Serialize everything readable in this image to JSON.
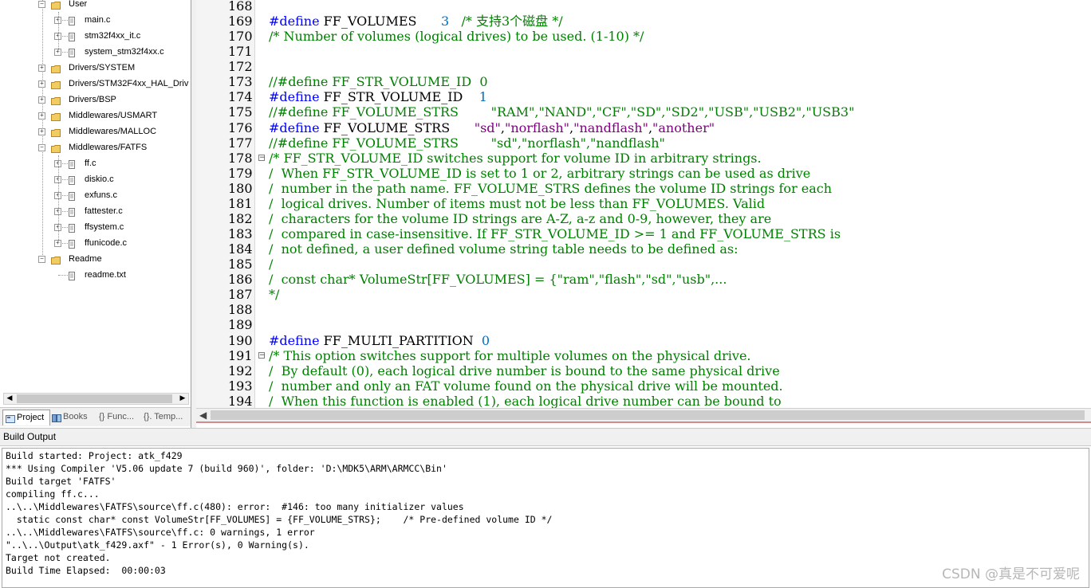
{
  "project_tree": {
    "items": [
      {
        "label": "User",
        "type": "folder",
        "expander": "−"
      },
      {
        "label": "main.c",
        "type": "file",
        "expander": "+"
      },
      {
        "label": "stm32f4xx_it.c",
        "type": "file",
        "expander": "+"
      },
      {
        "label": "system_stm32f4xx.c",
        "type": "file",
        "expander": "+"
      },
      {
        "label": "Drivers/SYSTEM",
        "type": "folder",
        "expander": "+"
      },
      {
        "label": "Drivers/STM32F4xx_HAL_Driv",
        "type": "folder",
        "expander": "+"
      },
      {
        "label": "Drivers/BSP",
        "type": "folder",
        "expander": "+"
      },
      {
        "label": "Middlewares/USMART",
        "type": "folder",
        "expander": "+"
      },
      {
        "label": "Middlewares/MALLOC",
        "type": "folder",
        "expander": "+"
      },
      {
        "label": "Middlewares/FATFS",
        "type": "folder",
        "expander": "−"
      },
      {
        "label": "ff.c",
        "type": "file",
        "expander": "+"
      },
      {
        "label": "diskio.c",
        "type": "file",
        "expander": "+"
      },
      {
        "label": "exfuns.c",
        "type": "file",
        "expander": "+"
      },
      {
        "label": "fattester.c",
        "type": "file",
        "expander": "+"
      },
      {
        "label": "ffsystem.c",
        "type": "file",
        "expander": "+"
      },
      {
        "label": "ffunicode.c",
        "type": "file",
        "expander": "+"
      },
      {
        "label": "Readme",
        "type": "folder",
        "expander": "−"
      },
      {
        "label": "readme.txt",
        "type": "file",
        "expander": ""
      }
    ],
    "scroll_left": "◀",
    "scroll_right": "▶"
  },
  "project_tabs": [
    {
      "label": "Project",
      "icon": "project-icon"
    },
    {
      "label": "Books",
      "icon": "books-icon"
    },
    {
      "label": "{} Func...",
      "icon": "functions-icon"
    },
    {
      "label": "{}. Temp...",
      "icon": "templates-icon"
    }
  ],
  "editor": {
    "scroll_left": "◀",
    "lines": [
      {
        "n": "168",
        "fold": "",
        "tokens": []
      },
      {
        "n": "169",
        "fold": "",
        "tokens": [
          {
            "c": "pp",
            "t": "#define"
          },
          {
            "c": "def",
            "t": " FF_VOLUMES      "
          },
          {
            "c": "num",
            "t": "3"
          },
          {
            "c": "cmt",
            "t": "   /* 支持3个磁盘 */"
          }
        ]
      },
      {
        "n": "170",
        "fold": "",
        "tokens": [
          {
            "c": "cmt",
            "t": "/* Number of volumes (logical drives) to be used. (1-10) */"
          }
        ]
      },
      {
        "n": "171",
        "fold": "",
        "tokens": []
      },
      {
        "n": "172",
        "fold": "",
        "tokens": []
      },
      {
        "n": "173",
        "fold": "",
        "tokens": [
          {
            "c": "cmt",
            "t": "//#define FF_STR_VOLUME_ID  0"
          }
        ]
      },
      {
        "n": "174",
        "fold": "",
        "tokens": [
          {
            "c": "pp",
            "t": "#define"
          },
          {
            "c": "def",
            "t": " FF_STR_VOLUME_ID    "
          },
          {
            "c": "num",
            "t": "1"
          }
        ]
      },
      {
        "n": "175",
        "fold": "",
        "tokens": [
          {
            "c": "cmt",
            "t": "//#define FF_VOLUME_STRS        \"RAM\",\"NAND\",\"CF\",\"SD\",\"SD2\",\"USB\",\"USB2\",\"USB3\""
          }
        ]
      },
      {
        "n": "176",
        "fold": "",
        "tokens": [
          {
            "c": "pp",
            "t": "#define"
          },
          {
            "c": "def",
            "t": " FF_VOLUME_STRS      "
          },
          {
            "c": "str",
            "t": "\"sd\""
          },
          {
            "c": "def",
            "t": ","
          },
          {
            "c": "str",
            "t": "\"norflash\""
          },
          {
            "c": "def",
            "t": ","
          },
          {
            "c": "str",
            "t": "\"nandflash\""
          },
          {
            "c": "def",
            "t": ","
          },
          {
            "c": "str",
            "t": "\"another\""
          }
        ]
      },
      {
        "n": "177",
        "fold": "",
        "tokens": [
          {
            "c": "cmt",
            "t": "//#define FF_VOLUME_STRS        \"sd\",\"norflash\",\"nandflash\""
          }
        ]
      },
      {
        "n": "178",
        "fold": "−",
        "tokens": [
          {
            "c": "cmt",
            "t": "/* FF_STR_VOLUME_ID switches support for volume ID in arbitrary strings."
          }
        ]
      },
      {
        "n": "179",
        "fold": "",
        "tokens": [
          {
            "c": "cmt",
            "t": "/  When FF_STR_VOLUME_ID is set to 1 or 2, arbitrary strings can be used as drive"
          }
        ]
      },
      {
        "n": "180",
        "fold": "",
        "tokens": [
          {
            "c": "cmt",
            "t": "/  number in the path name. FF_VOLUME_STRS defines the volume ID strings for each"
          }
        ]
      },
      {
        "n": "181",
        "fold": "",
        "tokens": [
          {
            "c": "cmt",
            "t": "/  logical drives. Number of items must not be less than FF_VOLUMES. Valid"
          }
        ]
      },
      {
        "n": "182",
        "fold": "",
        "tokens": [
          {
            "c": "cmt",
            "t": "/  characters for the volume ID strings are A-Z, a-z and 0-9, however, they are"
          }
        ]
      },
      {
        "n": "183",
        "fold": "",
        "tokens": [
          {
            "c": "cmt",
            "t": "/  compared in case-insensitive. If FF_STR_VOLUME_ID >= 1 and FF_VOLUME_STRS is"
          }
        ]
      },
      {
        "n": "184",
        "fold": "",
        "tokens": [
          {
            "c": "cmt",
            "t": "/  not defined, a user defined volume string table needs to be defined as:"
          }
        ]
      },
      {
        "n": "185",
        "fold": "",
        "tokens": [
          {
            "c": "cmt",
            "t": "/"
          }
        ]
      },
      {
        "n": "186",
        "fold": "",
        "tokens": [
          {
            "c": "cmt",
            "t": "/  const char* VolumeStr[FF_VOLUMES] = {\"ram\",\"flash\",\"sd\",\"usb\",..."
          }
        ]
      },
      {
        "n": "187",
        "fold": "",
        "tokens": [
          {
            "c": "cmt",
            "t": "*/"
          }
        ]
      },
      {
        "n": "188",
        "fold": "",
        "tokens": []
      },
      {
        "n": "189",
        "fold": "",
        "tokens": []
      },
      {
        "n": "190",
        "fold": "",
        "tokens": [
          {
            "c": "pp",
            "t": "#define"
          },
          {
            "c": "def",
            "t": " FF_MULTI_PARTITION  "
          },
          {
            "c": "num",
            "t": "0"
          }
        ]
      },
      {
        "n": "191",
        "fold": "−",
        "tokens": [
          {
            "c": "cmt",
            "t": "/* This option switches support for multiple volumes on the physical drive."
          }
        ]
      },
      {
        "n": "192",
        "fold": "",
        "tokens": [
          {
            "c": "cmt",
            "t": "/  By default (0), each logical drive number is bound to the same physical drive"
          }
        ]
      },
      {
        "n": "193",
        "fold": "",
        "tokens": [
          {
            "c": "cmt",
            "t": "/  number and only an FAT volume found on the physical drive will be mounted."
          }
        ]
      },
      {
        "n": "194",
        "fold": "",
        "tokens": [
          {
            "c": "cmt",
            "t": "/  When this function is enabled (1), each logical drive number can be bound to"
          }
        ]
      }
    ]
  },
  "build_output": {
    "title": "Build Output",
    "lines": [
      "Build started: Project: atk_f429",
      "*** Using Compiler 'V5.06 update 7 (build 960)', folder: 'D:\\MDK5\\ARM\\ARMCC\\Bin'",
      "Build target 'FATFS'",
      "compiling ff.c...",
      "..\\..\\Middlewares\\FATFS\\source\\ff.c(480): error:  #146: too many initializer values",
      "  static const char* const VolumeStr[FF_VOLUMES] = {FF_VOLUME_STRS};    /* Pre-defined volume ID */",
      "..\\..\\Middlewares\\FATFS\\source\\ff.c: 0 warnings, 1 error",
      "\"..\\..\\Output\\atk_f429.axf\" - 1 Error(s), 0 Warning(s).",
      "Target not created.",
      "Build Time Elapsed:  00:00:03"
    ]
  },
  "watermark": "CSDN @真是不可爱呢",
  "colors": {
    "comment": "#008000",
    "preprocessor": "#0000ff",
    "number": "#0070c0",
    "string": "#800080",
    "folder": "#e8b84a"
  }
}
